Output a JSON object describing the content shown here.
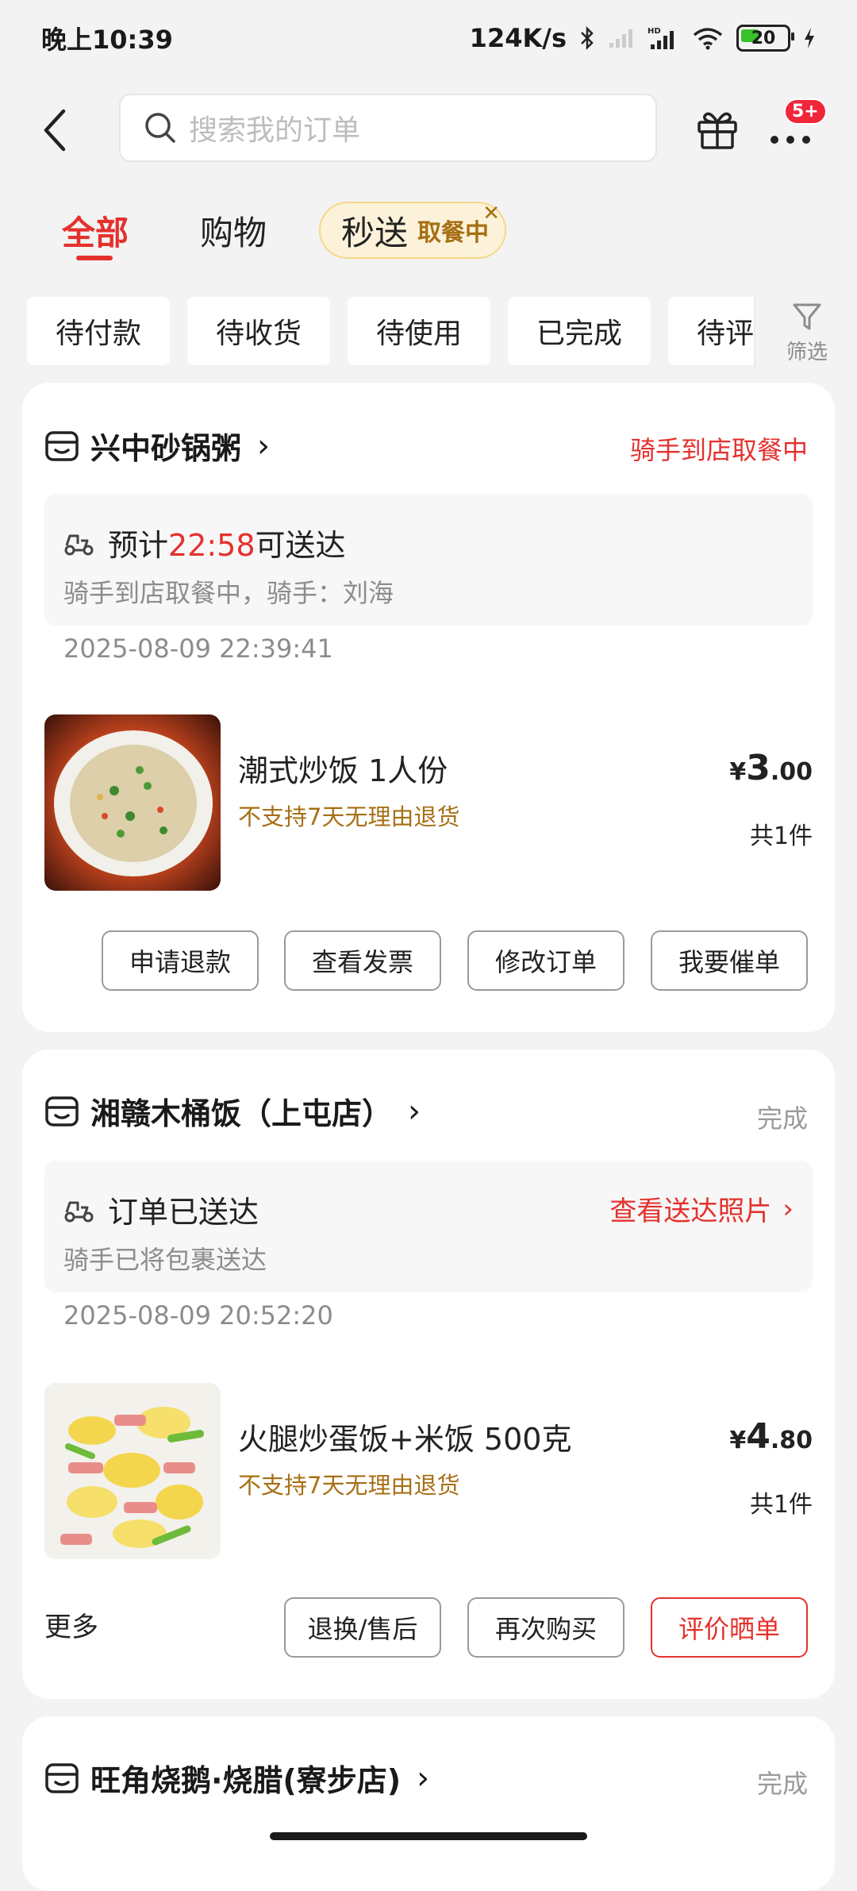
{
  "status_bar": {
    "time": "晚上10:39",
    "network_speed": "124K/s",
    "battery": "20",
    "icons": [
      "bluetooth-icon",
      "signal-icon",
      "signal-hd-icon",
      "wifi-icon",
      "battery-icon",
      "charging-icon"
    ]
  },
  "header": {
    "search_placeholder": "搜索我的订单",
    "badge": "5+"
  },
  "tabs": [
    {
      "label": "全部",
      "active": true
    },
    {
      "label": "购物",
      "active": false
    }
  ],
  "special_tab": {
    "label": "秒送",
    "sub": "取餐中",
    "close": "✕"
  },
  "filter_chips": [
    "待付款",
    "待收货",
    "待使用",
    "已完成",
    "待评"
  ],
  "filter": {
    "label": "筛选"
  },
  "orders": [
    {
      "shop": "兴中砂锅粥",
      "status": "骑手到店取餐中",
      "delivery": {
        "title_prefix": "预计",
        "eta": "22:58",
        "title_suffix": "可送达",
        "detail": "骑手到店取餐中，骑手：刘海",
        "time": "2025-08-09 22:39:41"
      },
      "product": {
        "name": "潮式炒饭 1人份",
        "note": "不支持7天无理由退货",
        "currency": "¥",
        "price_int": "3",
        "price_dec": ".00",
        "count": "共1件"
      },
      "buttons": [
        "申请退款",
        "查看发票",
        "修改订单",
        "我要催单"
      ]
    },
    {
      "shop": "湘赣木桶饭（上屯店）",
      "status": "完成",
      "delivery": {
        "title": "订单已送达",
        "link": "查看送达照片",
        "detail": "骑手已将包裹送达",
        "time": "2025-08-09 20:52:20"
      },
      "product": {
        "name": "火腿炒蛋饭+米饭 500克",
        "note": "不支持7天无理由退货",
        "currency": "¥",
        "price_int": "4",
        "price_dec": ".80",
        "count": "共1件"
      },
      "more": "更多",
      "buttons": [
        "退换/售后",
        "再次购买",
        "评价晒单"
      ]
    },
    {
      "shop": "旺角烧鹅·烧腊(寮步店)",
      "status": "完成"
    }
  ],
  "colors": {
    "accent": "#e4312d",
    "note": "#a76f15",
    "background": "#f3f3f3"
  }
}
